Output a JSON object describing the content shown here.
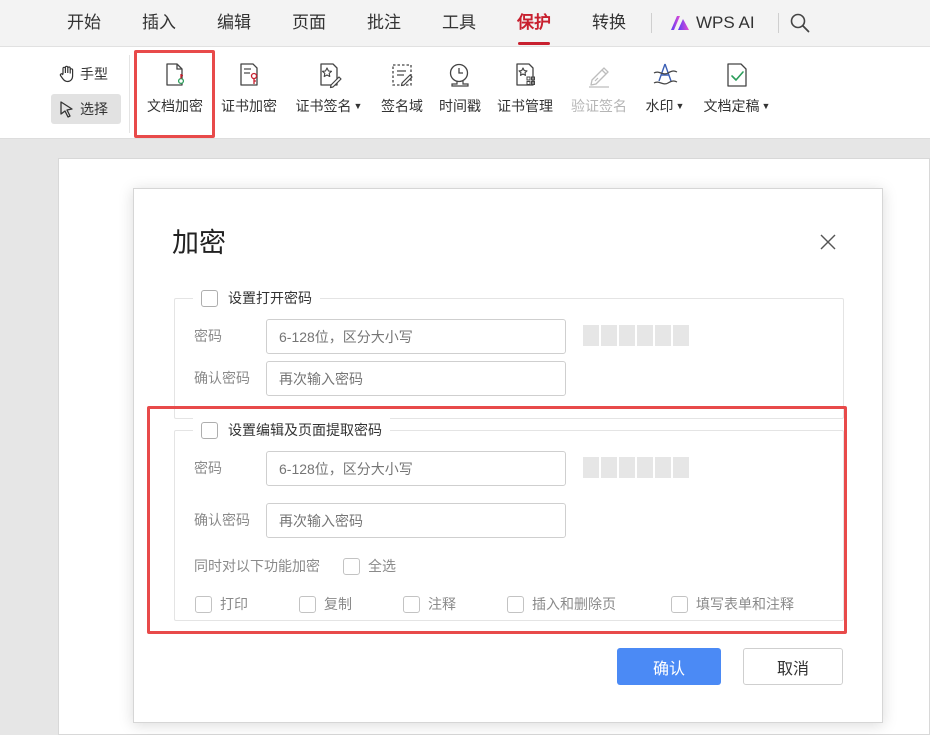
{
  "menubar": {
    "items": [
      "开始",
      "插入",
      "编辑",
      "页面",
      "批注",
      "工具",
      "保护",
      "转换"
    ],
    "active": "保护",
    "ai_label": "WPS AI"
  },
  "ribbon": {
    "hand_label": "手型",
    "select_label": "选择",
    "tools": [
      {
        "label": "文档加密",
        "icon": "document-lock-icon"
      },
      {
        "label": "证书加密",
        "icon": "certificate-encrypt-icon"
      },
      {
        "label": "证书签名",
        "icon": "certificate-sign-icon",
        "dropdown": true
      },
      {
        "label": "签名域",
        "icon": "signature-field-icon"
      },
      {
        "label": "时间戳",
        "icon": "timestamp-icon"
      },
      {
        "label": "证书管理",
        "icon": "certificate-manage-icon"
      },
      {
        "label": "验证签名",
        "icon": "verify-signature-icon",
        "disabled": true
      },
      {
        "label": "水印",
        "icon": "watermark-icon",
        "dropdown": true
      },
      {
        "label": "文档定稿",
        "icon": "document-finalize-icon",
        "dropdown": true
      }
    ]
  },
  "dialog": {
    "title": "加密",
    "open_password": {
      "checkbox_label": "设置打开密码",
      "password_label": "密码",
      "password_placeholder": "6-128位，区分大小写",
      "confirm_label": "确认密码",
      "confirm_placeholder": "再次输入密码"
    },
    "edit_password": {
      "checkbox_label": "设置编辑及页面提取密码",
      "password_label": "密码",
      "password_placeholder": "6-128位，区分大小写",
      "confirm_label": "确认密码",
      "confirm_placeholder": "再次输入密码",
      "also_encrypt_label": "同时对以下功能加密",
      "select_all_label": "全选",
      "features": [
        "打印",
        "复制",
        "注释",
        "插入和删除页",
        "填写表单和注释"
      ]
    },
    "ok_label": "确认",
    "cancel_label": "取消"
  },
  "colors": {
    "accent_red": "#c8202f",
    "highlight": "#e84a4a",
    "primary_button": "#4b8af5"
  }
}
